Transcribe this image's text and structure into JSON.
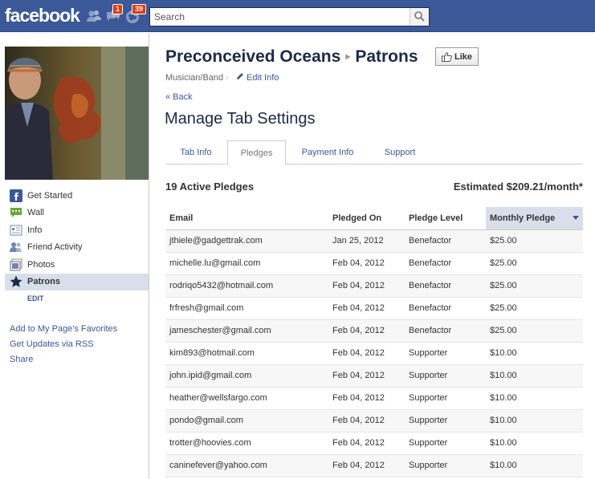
{
  "header": {
    "logo": "facebook",
    "friend_requests_count": "",
    "messages_count": "1",
    "notifications_count": "39",
    "search_placeholder": "Search"
  },
  "sidebar": {
    "items": [
      {
        "label": "Get Started",
        "icon": "get-started-icon"
      },
      {
        "label": "Wall",
        "icon": "wall-icon"
      },
      {
        "label": "Info",
        "icon": "info-icon"
      },
      {
        "label": "Friend Activity",
        "icon": "friend-activity-icon"
      },
      {
        "label": "Photos",
        "icon": "photos-icon"
      },
      {
        "label": "Patrons",
        "icon": "star-icon",
        "active": true
      }
    ],
    "edit_label": "EDIT",
    "links": [
      "Add to My Page's Favorites",
      "Get Updates via RSS",
      "Share"
    ]
  },
  "page": {
    "name": "Preconceived Oceans",
    "section": "Patrons",
    "like_label": "Like",
    "category": "Musician/Band",
    "separator": "·",
    "edit_info": "Edit Info",
    "back": "« Back",
    "heading": "Manage Tab Settings"
  },
  "tabs": [
    {
      "label": "Tab Info",
      "active": false
    },
    {
      "label": "Pledges",
      "active": true
    },
    {
      "label": "Payment Info",
      "active": false
    },
    {
      "label": "Support",
      "active": false
    }
  ],
  "summary": {
    "active_pledges": "19 Active Pledges",
    "estimated": "Estimated $209.21/month*"
  },
  "table": {
    "columns": [
      "Email",
      "Pledged On",
      "Pledge Level",
      "Monthly Pledge"
    ],
    "sorted_column": "Monthly Pledge",
    "rows": [
      [
        "jthiele@gadgettrak.com",
        "Jan 25, 2012",
        "Benefactor",
        "$25.00"
      ],
      [
        "michelle.lu@gmail.com",
        "Feb 04, 2012",
        "Benefactor",
        "$25.00"
      ],
      [
        "rodriqo5432@hotmail.com",
        "Feb 04, 2012",
        "Benefactor",
        "$25.00"
      ],
      [
        "frfresh@gmail.com",
        "Feb 04, 2012",
        "Benefactor",
        "$25.00"
      ],
      [
        "jameschester@gmail.com",
        "Feb 04, 2012",
        "Benefactor",
        "$25.00"
      ],
      [
        "kim893@hotmail.com",
        "Feb 04, 2012",
        "Supporter",
        "$10.00"
      ],
      [
        "john.ipid@gmail.com",
        "Feb 04, 2012",
        "Supporter",
        "$10.00"
      ],
      [
        "heather@wellsfargo.com",
        "Feb 04, 2012",
        "Supporter",
        "$10.00"
      ],
      [
        "pondo@gmail.com",
        "Feb 04, 2012",
        "Supporter",
        "$10.00"
      ],
      [
        "trotter@hoovies.com",
        "Feb 04, 2012",
        "Supporter",
        "$10.00"
      ],
      [
        "caninefever@yahoo.com",
        "Feb 04, 2012",
        "Supporter",
        "$10.00"
      ]
    ]
  },
  "colors": {
    "brand": "#3b5998",
    "badge": "#dd3c10",
    "active_bg": "#d8dfea"
  }
}
